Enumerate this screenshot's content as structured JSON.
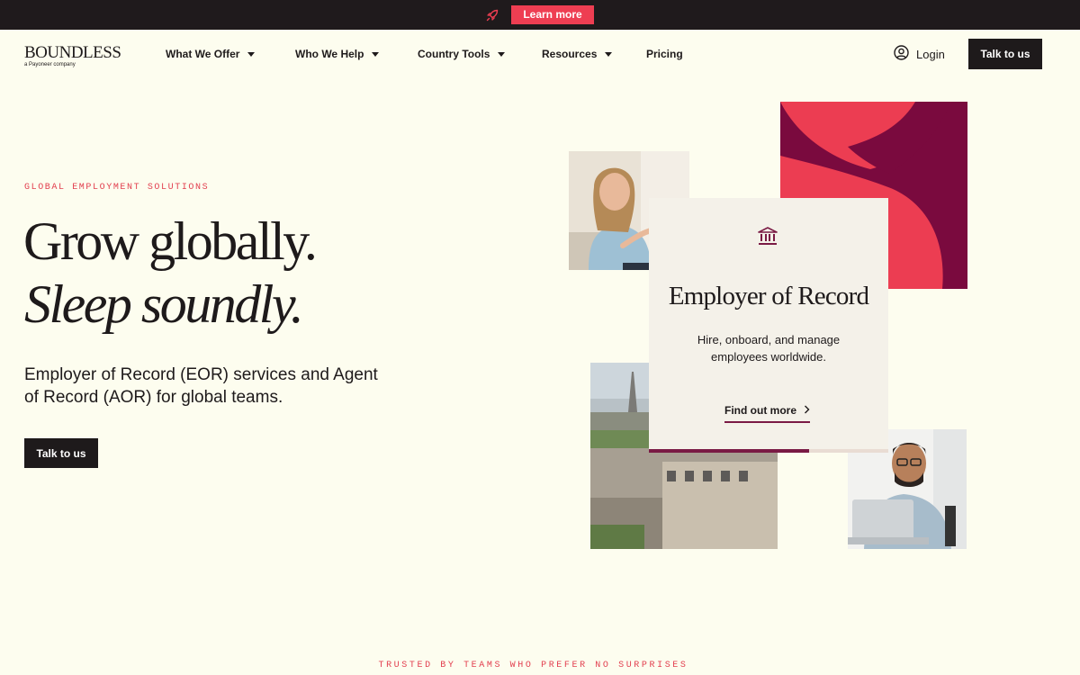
{
  "announcement": {
    "icon": "rocket-icon",
    "cta_label": "Learn more",
    "accent_color": "#ee3e52"
  },
  "header": {
    "logo": {
      "wordmark": "BOUNDLESS",
      "tagline": "a Payoneer company"
    },
    "nav": [
      {
        "label": "What We Offer",
        "has_dropdown": true
      },
      {
        "label": "Who We Help",
        "has_dropdown": true
      },
      {
        "label": "Country Tools",
        "has_dropdown": true
      },
      {
        "label": "Resources",
        "has_dropdown": true
      },
      {
        "label": "Pricing",
        "has_dropdown": false
      }
    ],
    "login_label": "Login",
    "cta_label": "Talk to us"
  },
  "hero": {
    "eyebrow": "GLOBAL EMPLOYMENT SOLUTIONS",
    "headline_line1": "Grow globally.",
    "headline_line2": "Sleep soundly.",
    "lead": "Employer of Record (EOR) services and Agent of Record (AOR) for global teams.",
    "cta_label": "Talk to us"
  },
  "feature_card": {
    "icon": "bank-icon",
    "title": "Employer of Record",
    "description": "Hire, onboard, and manage employees worldwide.",
    "link_label": "Find out more",
    "progress": 0.67
  },
  "trusted": {
    "text": "TRUSTED BY TEAMS WHO PREFER NO SURPRISES"
  },
  "colors": {
    "background": "#fdfdef",
    "ink": "#1e1a1b",
    "accent_red": "#ee3e52",
    "plum": "#7a1a44",
    "card": "#f4f1e9"
  }
}
